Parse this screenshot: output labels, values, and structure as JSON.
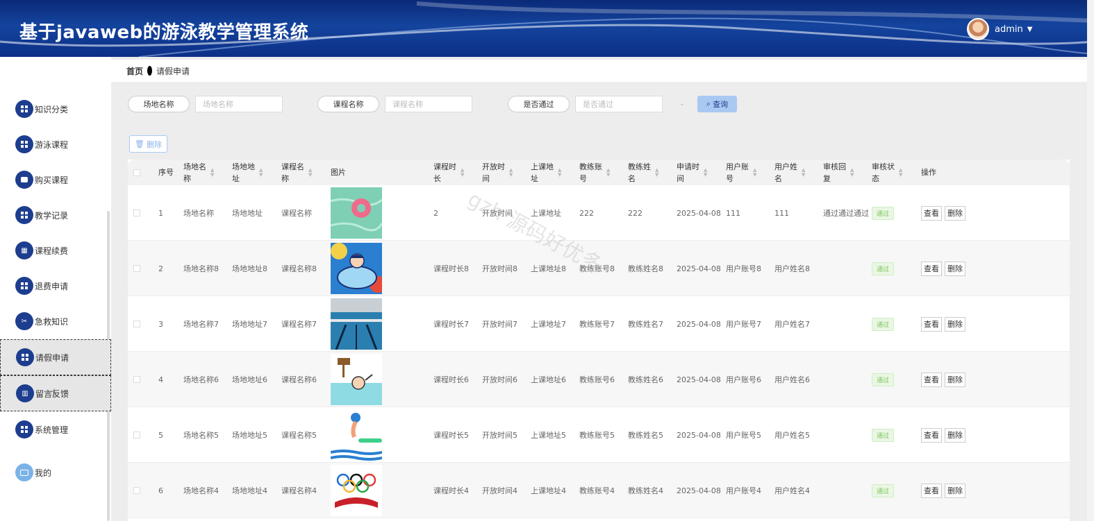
{
  "header": {
    "title": "基于javaweb的游泳教学管理系统",
    "user": "admin"
  },
  "sidebar": {
    "items": [
      {
        "label": "知识分类",
        "icon": "grid-icon"
      },
      {
        "label": "游泳课程",
        "icon": "grid-icon"
      },
      {
        "label": "购买课程",
        "icon": "cart-icon"
      },
      {
        "label": "教学记录",
        "icon": "grid-icon"
      },
      {
        "label": "课程续费",
        "icon": "apps-icon"
      },
      {
        "label": "退费申请",
        "icon": "grid-icon"
      },
      {
        "label": "急救知识",
        "icon": "ticket-icon"
      },
      {
        "label": "请假申请",
        "icon": "grid-icon"
      },
      {
        "label": "留言反馈",
        "icon": "chart-icon"
      },
      {
        "label": "系统管理",
        "icon": "grid-icon"
      },
      {
        "label": "我的",
        "icon": "card-icon"
      }
    ]
  },
  "breadcrumb": {
    "home": "首页",
    "current": "请假申请"
  },
  "search": {
    "venue_label": "场地名称",
    "venue_placeholder": "场地名称",
    "course_label": "课程名称",
    "course_placeholder": "课程名称",
    "pass_label": "是否通过",
    "pass_placeholder": "是否通过",
    "query_button": "查询"
  },
  "toolbar": {
    "delete_button": "删除"
  },
  "table": {
    "headers": {
      "index": "序号",
      "venue_name": [
        "场地名",
        "称"
      ],
      "venue_addr": [
        "场地地",
        "址"
      ],
      "course_name": [
        "课程名",
        "称"
      ],
      "image": "图片",
      "duration": [
        "课程时",
        "长"
      ],
      "open_time": [
        "开放时",
        "间"
      ],
      "class_addr": [
        "上课地",
        "址"
      ],
      "coach_account": [
        "教练账",
        "号"
      ],
      "coach_name": [
        "教练姓",
        "名"
      ],
      "apply_time": [
        "申请时",
        "间"
      ],
      "user_account": [
        "用户账",
        "号"
      ],
      "user_name": [
        "用户姓",
        "名"
      ],
      "review_reply": [
        "审核回",
        "复"
      ],
      "review_status": [
        "审核状",
        "态"
      ],
      "actions": "操作"
    },
    "rows": [
      {
        "index": "1",
        "venue_name": "场地名称",
        "venue_addr": "场地地址",
        "course_name": "课程名称",
        "image": "swim-ring-image",
        "duration": "2",
        "open_time": "开放时间",
        "class_addr": "上课地址",
        "coach_account": "222",
        "coach_name": "222",
        "apply_time": "2025-04-08",
        "user_account": "111",
        "user_name": "111",
        "review_reply": "通过通过通过",
        "review_status": "通过"
      },
      {
        "index": "2",
        "venue_name": "场地名称8",
        "venue_addr": "场地地址8",
        "course_name": "课程名称8",
        "image": "cartoon-swimmer-image",
        "duration": "课程时长8",
        "open_time": "开放时间8",
        "class_addr": "上课地址8",
        "coach_account": "教练账号8",
        "coach_name": "教练姓名8",
        "apply_time": "2025-04-08",
        "user_account": "用户账号8",
        "user_name": "用户姓名8",
        "review_reply": "",
        "review_status": "通过"
      },
      {
        "index": "3",
        "venue_name": "场地名称7",
        "venue_addr": "场地地址7",
        "course_name": "课程名称7",
        "image": "pool-lanes-image",
        "duration": "课程时长7",
        "open_time": "开放时间7",
        "class_addr": "上课地址7",
        "coach_account": "教练账号7",
        "coach_name": "教练姓名7",
        "apply_time": "2025-04-08",
        "user_account": "用户账号7",
        "user_name": "用户姓名7",
        "review_reply": "",
        "review_status": "通过"
      },
      {
        "index": "4",
        "venue_name": "场地名称6",
        "venue_addr": "场地地址6",
        "course_name": "课程名称6",
        "image": "drowning-sign-image",
        "duration": "课程时长6",
        "open_time": "开放时间6",
        "class_addr": "上课地址6",
        "coach_account": "教练账号6",
        "coach_name": "教练姓名6",
        "apply_time": "2025-04-08",
        "user_account": "用户账号6",
        "user_name": "用户姓名6",
        "review_reply": "",
        "review_status": "通过"
      },
      {
        "index": "5",
        "venue_name": "场地名称5",
        "venue_addr": "场地地址5",
        "course_name": "课程名称5",
        "image": "diver-image",
        "duration": "课程时长5",
        "open_time": "开放时间5",
        "class_addr": "上课地址5",
        "coach_account": "教练账号5",
        "coach_name": "教练姓名5",
        "apply_time": "2025-04-08",
        "user_account": "用户账号5",
        "user_name": "用户姓名5",
        "review_reply": "",
        "review_status": "通过"
      },
      {
        "index": "6",
        "venue_name": "场地名称4",
        "venue_addr": "场地地址4",
        "course_name": "课程名称4",
        "image": "olympic-rings-image",
        "duration": "课程时长4",
        "open_time": "开放时间4",
        "class_addr": "上课地址4",
        "coach_account": "教练账号4",
        "coach_name": "教练姓名4",
        "apply_time": "2025-04-08",
        "user_account": "用户账号4",
        "user_name": "用户姓名4",
        "review_reply": "",
        "review_status": "通过"
      }
    ],
    "action_view": "查看",
    "action_delete": "删除"
  },
  "watermark": "gzh 源码好优多",
  "colors": {
    "header": "#14449e",
    "sidebar_icon": "#1d3d8f",
    "query_button": "#a9c9f2",
    "pass_tag": "#7dc45a"
  }
}
